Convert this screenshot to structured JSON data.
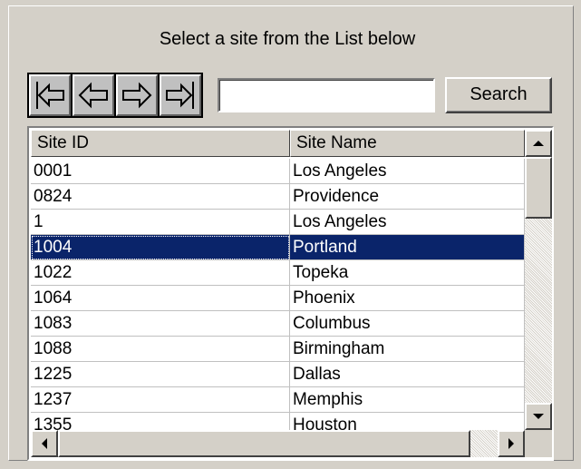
{
  "instruction": "Select a site from the List below",
  "nav": {
    "first": "first-record",
    "prev": "previous-record",
    "next": "next-record",
    "last": "last-record"
  },
  "search": {
    "value": "",
    "button_label": "Search"
  },
  "grid": {
    "columns": [
      "Site ID",
      "Site Name"
    ],
    "selected_index": 3,
    "rows": [
      {
        "id": "0001",
        "name": "Los Angeles"
      },
      {
        "id": "0824",
        "name": "Providence"
      },
      {
        "id": "1",
        "name": "Los Angeles"
      },
      {
        "id": "1004",
        "name": "Portland"
      },
      {
        "id": "1022",
        "name": "Topeka"
      },
      {
        "id": "1064",
        "name": "Phoenix"
      },
      {
        "id": "1083",
        "name": "Columbus"
      },
      {
        "id": "1088",
        "name": "Birmingham"
      },
      {
        "id": "1225",
        "name": "Dallas"
      },
      {
        "id": "1237",
        "name": "Memphis"
      },
      {
        "id": "1355",
        "name": "Houston"
      }
    ]
  },
  "colors": {
    "face": "#d4d0c8",
    "selection": "#0a246a"
  }
}
